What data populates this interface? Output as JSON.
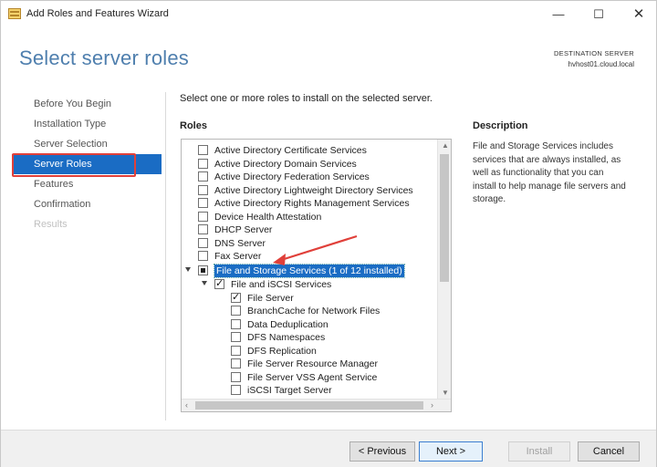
{
  "window": {
    "title": "Add Roles and Features Wizard",
    "controls": {
      "minimize": "—",
      "maximize": "☐",
      "close": "✕"
    }
  },
  "header": {
    "page_title": "Select server roles",
    "destination_label": "DESTINATION SERVER",
    "destination_value": "hvhost01.cloud.local"
  },
  "nav": {
    "items": [
      {
        "label": "Before You Begin",
        "state": "normal"
      },
      {
        "label": "Installation Type",
        "state": "normal"
      },
      {
        "label": "Server Selection",
        "state": "normal"
      },
      {
        "label": "Server Roles",
        "state": "selected"
      },
      {
        "label": "Features",
        "state": "normal"
      },
      {
        "label": "Confirmation",
        "state": "normal"
      },
      {
        "label": "Results",
        "state": "disabled"
      }
    ]
  },
  "content": {
    "instructions": "Select one or more roles to install on the selected server.",
    "roles_heading": "Roles",
    "description_heading": "Description",
    "description_text": "File and Storage Services includes services that are always installed, as well as functionality that you can install to help manage file servers and storage."
  },
  "roles": [
    {
      "label": "Active Directory Certificate Services",
      "state": "unchecked",
      "level": 0
    },
    {
      "label": "Active Directory Domain Services",
      "state": "unchecked",
      "level": 0
    },
    {
      "label": "Active Directory Federation Services",
      "state": "unchecked",
      "level": 0
    },
    {
      "label": "Active Directory Lightweight Directory Services",
      "state": "unchecked",
      "level": 0
    },
    {
      "label": "Active Directory Rights Management Services",
      "state": "unchecked",
      "level": 0
    },
    {
      "label": "Device Health Attestation",
      "state": "unchecked",
      "level": 0
    },
    {
      "label": "DHCP Server",
      "state": "unchecked",
      "level": 0
    },
    {
      "label": "DNS Server",
      "state": "unchecked",
      "level": 0
    },
    {
      "label": "Fax Server",
      "state": "unchecked",
      "level": 0
    },
    {
      "label": "File and Storage Services (1 of 12 installed)",
      "state": "partial",
      "level": 0,
      "expanded": true,
      "highlighted": true
    },
    {
      "label": "File and iSCSI Services",
      "state": "checked",
      "level": 1,
      "expanded": true
    },
    {
      "label": "File Server",
      "state": "checked",
      "level": 2
    },
    {
      "label": "BranchCache for Network Files",
      "state": "unchecked",
      "level": 2
    },
    {
      "label": "Data Deduplication",
      "state": "unchecked",
      "level": 2
    },
    {
      "label": "DFS Namespaces",
      "state": "unchecked",
      "level": 2
    },
    {
      "label": "DFS Replication",
      "state": "unchecked",
      "level": 2
    },
    {
      "label": "File Server Resource Manager",
      "state": "unchecked",
      "level": 2
    },
    {
      "label": "File Server VSS Agent Service",
      "state": "unchecked",
      "level": 2
    },
    {
      "label": "iSCSI Target Server",
      "state": "unchecked",
      "level": 2
    }
  ],
  "footer": {
    "previous_label": "< Previous",
    "next_label": "Next >",
    "install_label": "Install",
    "cancel_label": "Cancel"
  },
  "colors": {
    "accent": "#1a6cc4",
    "title_blue": "#4f7fae",
    "annotation_red": "#e0403a"
  }
}
